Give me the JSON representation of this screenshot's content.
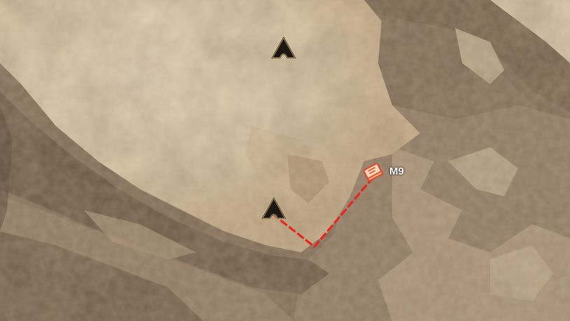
{
  "map": {
    "markers": [
      {
        "type": "camp",
        "icon": "tent-icon"
      },
      {
        "type": "camp",
        "icon": "tent-icon"
      },
      {
        "type": "note",
        "icon": "note-book-icon",
        "label": "M9"
      }
    ],
    "route": {
      "style": "dashed",
      "color": "#e8261e"
    }
  }
}
